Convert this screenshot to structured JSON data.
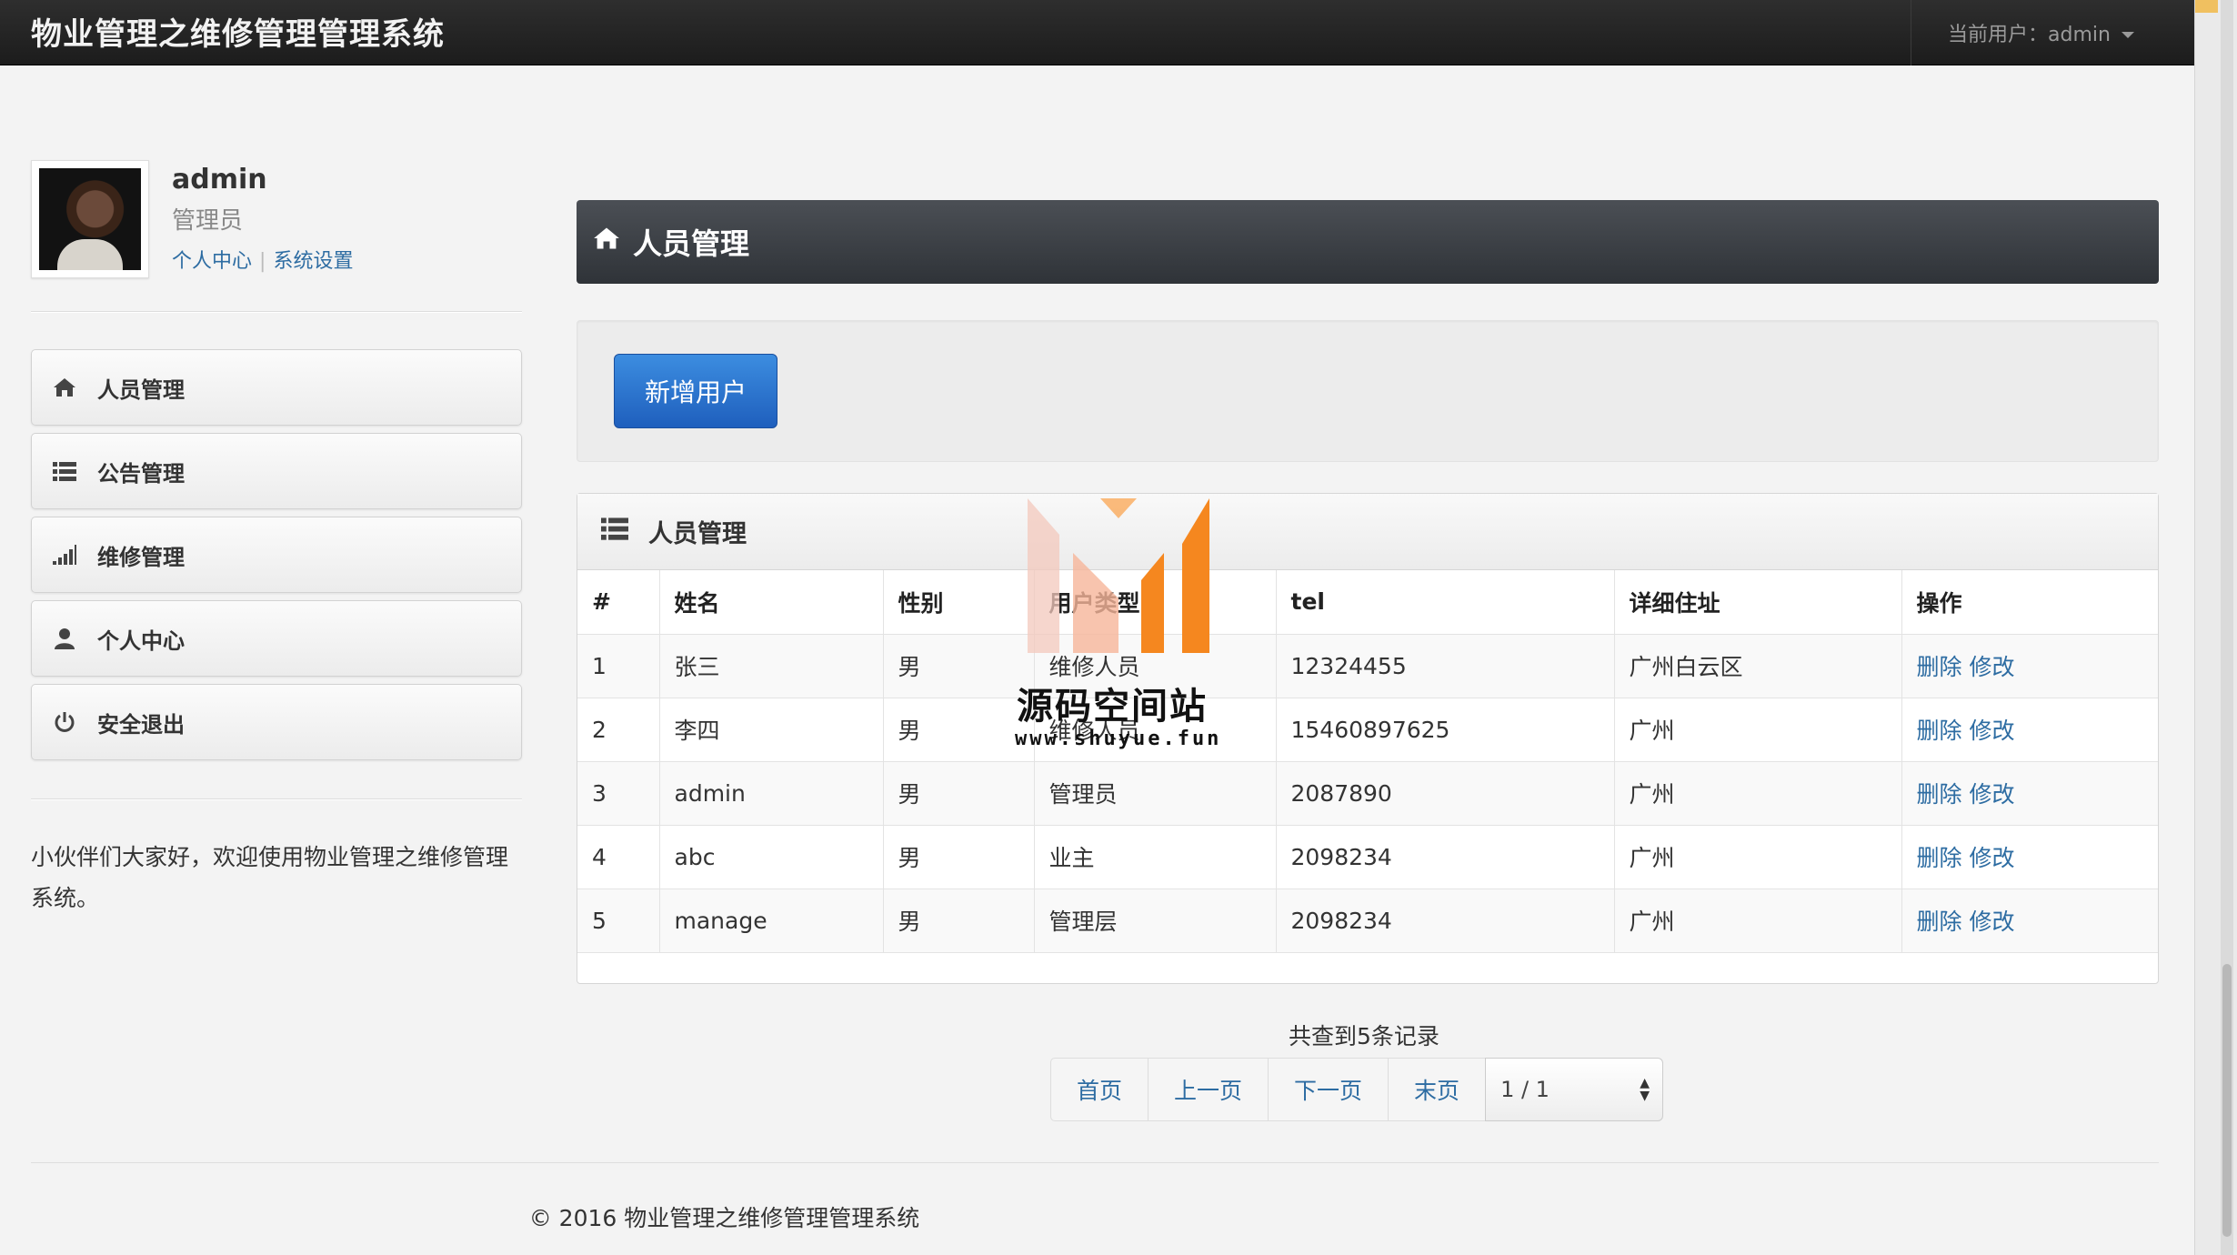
{
  "app": {
    "title": "物业管理之维修管理管理系统",
    "current_user_label": "当前用户：admin"
  },
  "profile": {
    "name": "admin",
    "role": "管理员",
    "link_center": "个人中心",
    "link_settings": "系统设置"
  },
  "sidebar": {
    "items": [
      {
        "label": "人员管理",
        "icon": "home-icon"
      },
      {
        "label": "公告管理",
        "icon": "list-icon"
      },
      {
        "label": "维修管理",
        "icon": "signal-icon"
      },
      {
        "label": "个人中心",
        "icon": "user-icon"
      },
      {
        "label": "安全退出",
        "icon": "power-icon"
      }
    ],
    "welcome": "小伙伴们大家好，欢迎使用物业管理之维修管理系统。"
  },
  "main": {
    "header_title": "人员管理",
    "add_button": "新增用户",
    "table_title": "人员管理",
    "columns": [
      "#",
      "姓名",
      "性别",
      "用户类型",
      "tel",
      "详细住址",
      "操作"
    ],
    "rows": [
      [
        "1",
        "张三",
        "男",
        "维修人员",
        "12324455",
        "广州白云区"
      ],
      [
        "2",
        "李四",
        "男",
        "维修人员",
        "15460897625",
        "广州"
      ],
      [
        "3",
        "admin",
        "男",
        "管理员",
        "2087890",
        "广州"
      ],
      [
        "4",
        "abc",
        "男",
        "业主",
        "2098234",
        "广州"
      ],
      [
        "5",
        "manage",
        "男",
        "管理层",
        "2098234",
        "广州"
      ]
    ],
    "action_delete": "删除",
    "action_edit": "修改"
  },
  "pager": {
    "info": "共查到5条记录",
    "first": "首页",
    "prev": "上一页",
    "next": "下一页",
    "last": "末页",
    "page_select": "1 / 1"
  },
  "footer": {
    "text": "© 2016 物业管理之维修管理管理系统"
  },
  "watermark": {
    "text": "源码空间站",
    "url": "www.shuyue.fun"
  },
  "colors": {
    "link": "#2d6ca2",
    "primary_button": "#2a72cf",
    "header_dark": "#3a3e44",
    "watermark_orange": "#f5871f"
  }
}
